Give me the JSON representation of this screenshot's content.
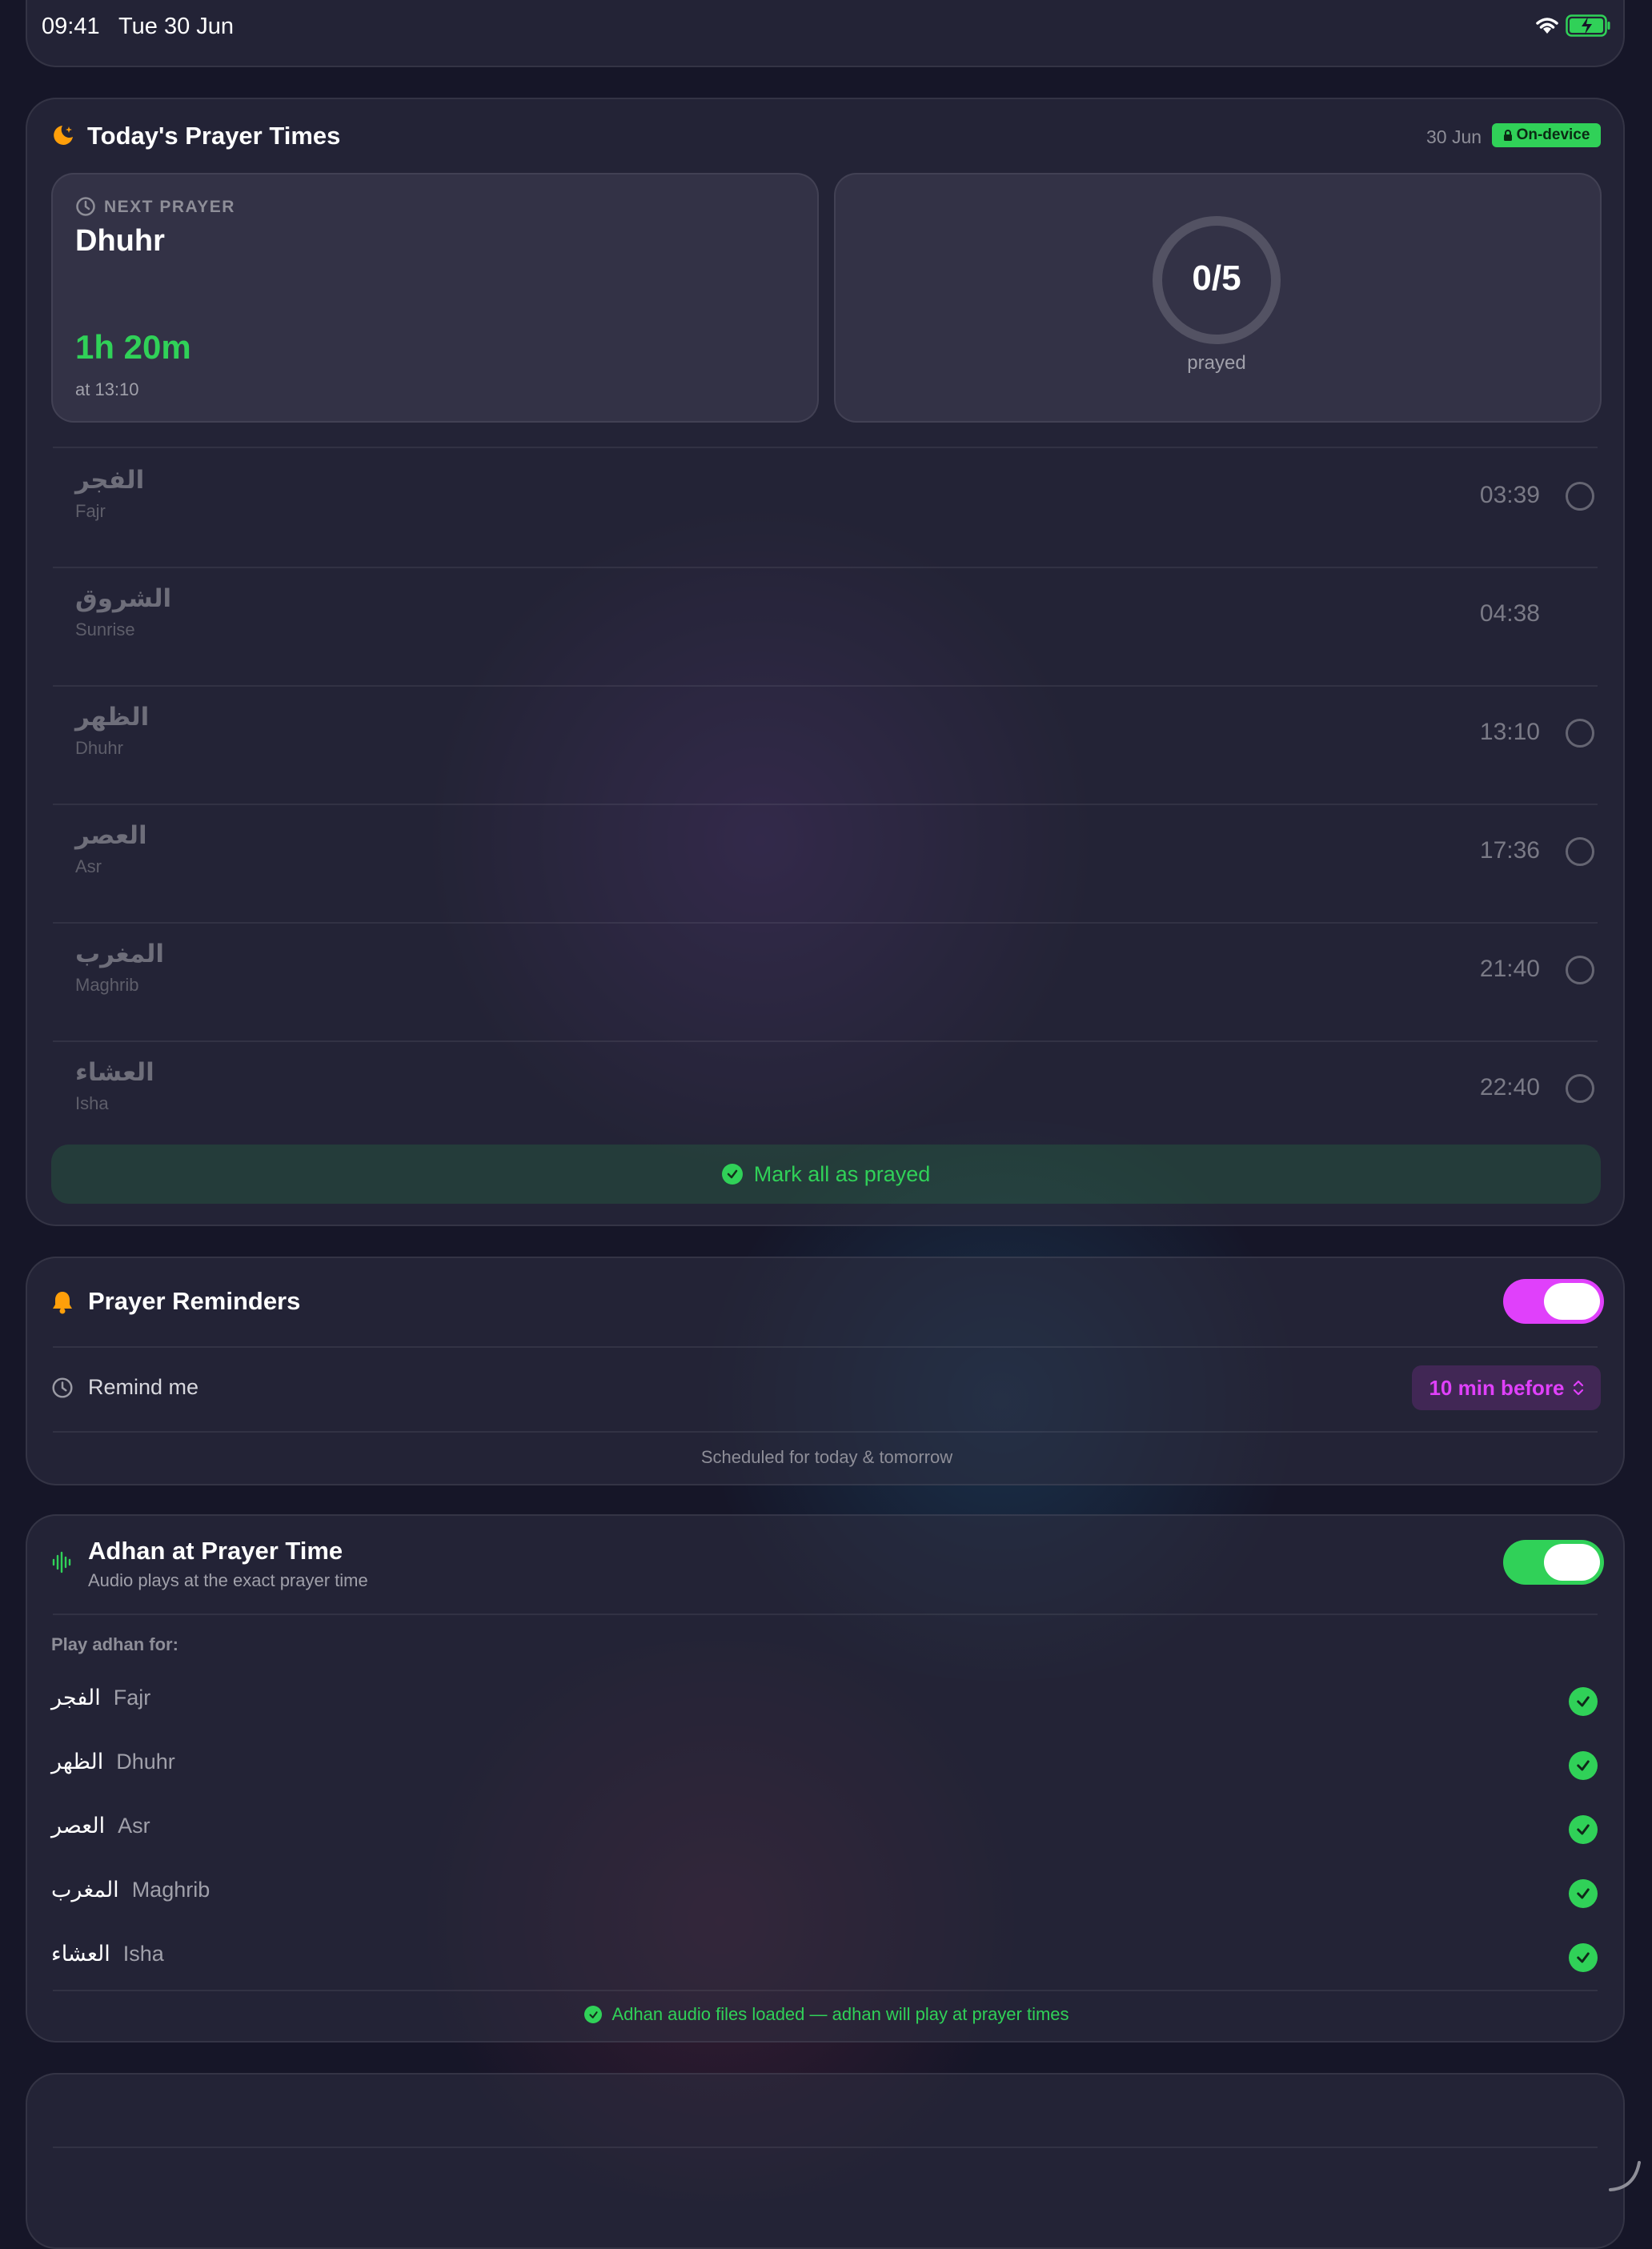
{
  "status_bar": {
    "time": "09:41",
    "date": "Tue 30 Jun"
  },
  "prayer_times": {
    "title": "Today's Prayer Times",
    "date": "30 Jun",
    "badge": "On-device",
    "next": {
      "label": "NEXT PRAYER",
      "name": "Dhuhr",
      "countdown": "1h 20m",
      "at": "at 13:10"
    },
    "progress": {
      "text": "0/5",
      "label": "prayed",
      "completed": 0,
      "total": 5
    },
    "rows": [
      {
        "arabic": "الفجر",
        "english": "Fajr",
        "time": "03:39",
        "checkable": true
      },
      {
        "arabic": "الشروق",
        "english": "Sunrise",
        "time": "04:38",
        "checkable": false
      },
      {
        "arabic": "الظهر",
        "english": "Dhuhr",
        "time": "13:10",
        "checkable": true
      },
      {
        "arabic": "العصر",
        "english": "Asr",
        "time": "17:36",
        "checkable": true
      },
      {
        "arabic": "المغرب",
        "english": "Maghrib",
        "time": "21:40",
        "checkable": true
      },
      {
        "arabic": "العشاء",
        "english": "Isha",
        "time": "22:40",
        "checkable": true
      }
    ],
    "mark_all_label": "Mark all as prayed"
  },
  "reminders": {
    "title": "Prayer Reminders",
    "enabled": true,
    "remind_label": "Remind me",
    "remind_value": "10 min before",
    "footer": "Scheduled for today & tomorrow"
  },
  "adhan": {
    "title": "Adhan at Prayer Time",
    "subtitle": "Audio plays at the exact prayer time",
    "enabled": true,
    "play_for_label": "Play adhan for:",
    "prayers": [
      {
        "arabic": "الفجر",
        "english": "Fajr"
      },
      {
        "arabic": "الظهر",
        "english": "Dhuhr"
      },
      {
        "arabic": "العصر",
        "english": "Asr"
      },
      {
        "arabic": "المغرب",
        "english": "Maghrib"
      },
      {
        "arabic": "العشاء",
        "english": "Isha"
      }
    ],
    "status": "Adhan audio files loaded — adhan will play at prayer times"
  },
  "colors": {
    "green": "#30d158",
    "magenta": "#e040fb",
    "orange": "#ff9f0a",
    "card": "#2b2b3c"
  },
  "icons": {
    "moon": "moon-icon",
    "lock": "lock-icon",
    "timer": "timer-icon",
    "bell": "bell-icon",
    "waveform": "waveform-icon",
    "check": "checkmark-circle-icon",
    "wifi": "wifi-icon",
    "battery": "battery-charging-icon"
  }
}
